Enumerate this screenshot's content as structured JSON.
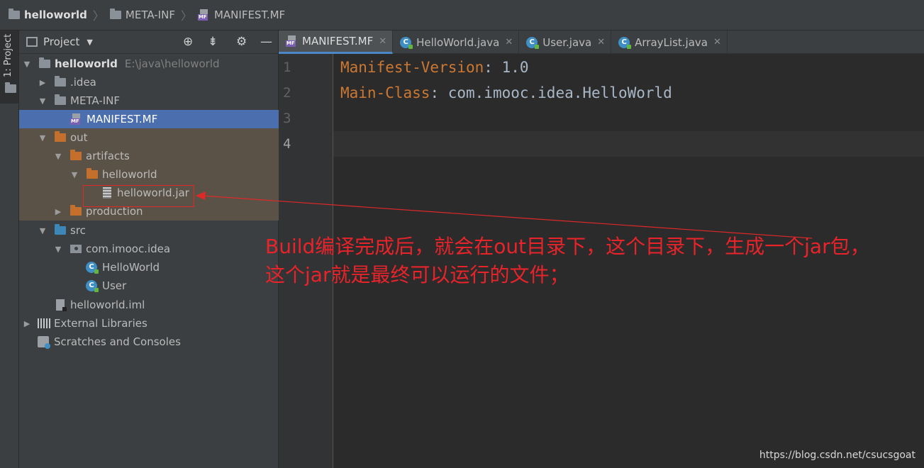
{
  "breadcrumb": {
    "items": [
      "helloworld",
      "META-INF",
      "MANIFEST.MF"
    ]
  },
  "sidebar_strip": {
    "tab_label": "1: Project"
  },
  "project_panel": {
    "title": "Project",
    "tree": [
      {
        "label": "helloworld",
        "path": "E:\\java\\helloworld"
      },
      {
        "label": ".idea"
      },
      {
        "label": "META-INF"
      },
      {
        "label": "MANIFEST.MF"
      },
      {
        "label": "out"
      },
      {
        "label": "artifacts"
      },
      {
        "label": "helloworld"
      },
      {
        "label": "helloworld.jar"
      },
      {
        "label": "production"
      },
      {
        "label": "src"
      },
      {
        "label": "com.imooc.idea"
      },
      {
        "label": "HelloWorld"
      },
      {
        "label": "User"
      },
      {
        "label": "helloworld.iml"
      },
      {
        "label": "External Libraries"
      },
      {
        "label": "Scratches and Consoles"
      }
    ]
  },
  "editor": {
    "tabs": [
      {
        "label": "MANIFEST.MF",
        "active": true
      },
      {
        "label": "HelloWorld.java"
      },
      {
        "label": "User.java"
      },
      {
        "label": "ArrayList.java"
      }
    ],
    "line_numbers": [
      "1",
      "2",
      "3",
      "4"
    ],
    "lines": [
      {
        "key": "Manifest-Version",
        "sep": ": ",
        "value": "1.0"
      },
      {
        "key": "Main-Class",
        "sep": ": ",
        "value": "com.imooc.idea.HelloWorld"
      }
    ]
  },
  "annotation": {
    "text": "Build编译完成后，就会在out目录下，这个目录下，生成一个jar包，这个jar就是最终可以运行的文件；",
    "color": "#e8232a"
  },
  "watermark": "https://blog.csdn.net/csucsgoat",
  "colors": {
    "selection": "#4b6eaf",
    "keyword": "#cc7832",
    "annotation_red": "#e8232a"
  }
}
